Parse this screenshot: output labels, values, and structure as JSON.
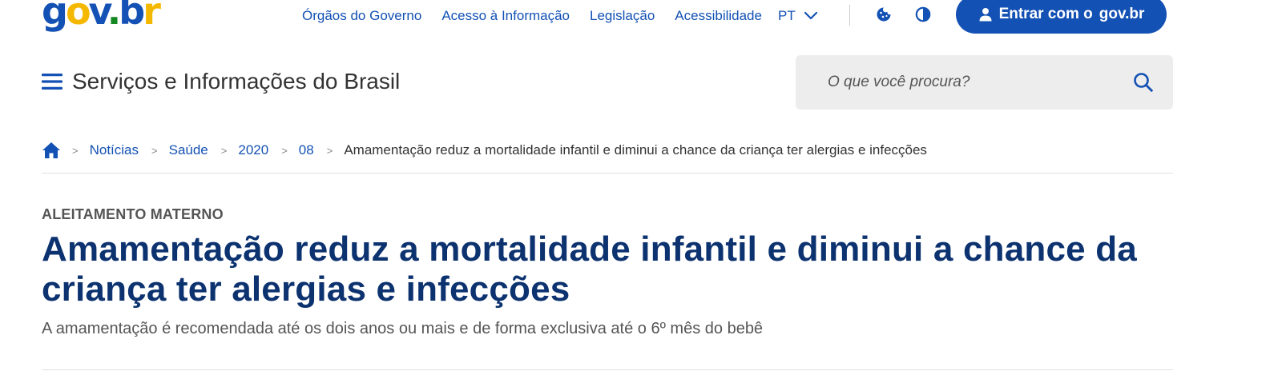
{
  "brand": {
    "logo_text": "gov.br",
    "colors": {
      "primary": "#1351b4",
      "yellow": "#f5b800",
      "green": "#168821",
      "title": "#0c326f"
    }
  },
  "topbar": {
    "links": [
      "Órgãos do Governo",
      "Acesso à Informação",
      "Legislação",
      "Acessibilidade"
    ],
    "language": "PT",
    "icons": [
      "cookie-icon",
      "contrast-icon",
      "user-icon",
      "chevron-down-icon"
    ],
    "login_label": "Entrar com o",
    "login_brand": "gov.br"
  },
  "header": {
    "site_title": "Serviços e Informações do Brasil",
    "search_placeholder": "O que você procura?"
  },
  "breadcrumb": {
    "items": [
      "Notícias",
      "Saúde",
      "2020",
      "08"
    ],
    "current": "Amamentação reduz a mortalidade infantil e diminui a chance da criança ter alergias e infecções"
  },
  "article": {
    "kicker": "ALEITAMENTO MATERNO",
    "title": "Amamentação reduz a mortalidade infantil e diminui a chance da criança ter alergias e infecções",
    "subtitle": "A amamentação é recomendada até os dois anos ou mais e de forma exclusiva até o 6º mês do bebê"
  }
}
